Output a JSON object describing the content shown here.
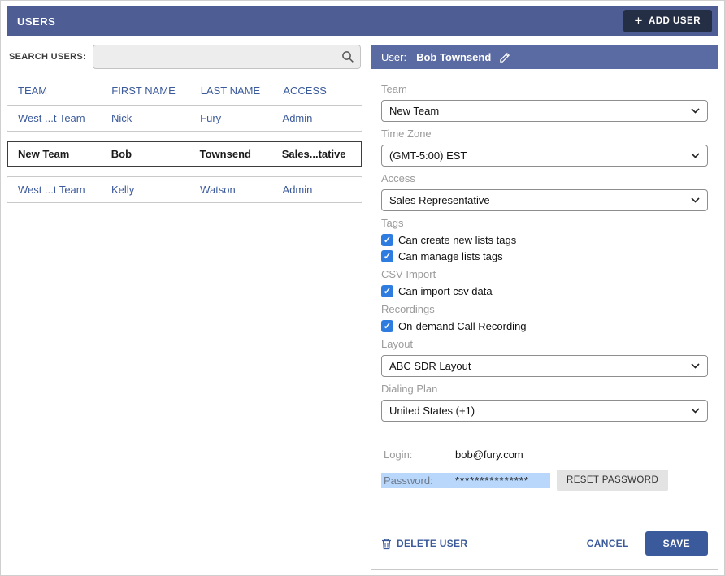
{
  "topbar": {
    "title": "USERS",
    "add_user_label": "ADD USER"
  },
  "search": {
    "label": "SEARCH USERS:",
    "value": ""
  },
  "table": {
    "columns": [
      "TEAM",
      "FIRST NAME",
      "LAST NAME",
      "ACCESS"
    ],
    "rows": [
      {
        "team": "West ...t Team",
        "first": "Nick",
        "last": "Fury",
        "access": "Admin"
      },
      {
        "team": "New Team",
        "first": "Bob",
        "last": "Townsend",
        "access": "Sales...tative"
      },
      {
        "team": "West ...t Team",
        "first": "Kelly",
        "last": "Watson",
        "access": "Admin"
      }
    ]
  },
  "detail": {
    "header": {
      "label": "User:",
      "name": "Bob Townsend"
    },
    "team": {
      "label": "Team",
      "value": "New Team"
    },
    "timezone": {
      "label": "Time Zone",
      "value": "(GMT-5:00) EST"
    },
    "access": {
      "label": "Access",
      "value": "Sales Representative"
    },
    "tags": {
      "label": "Tags",
      "option1": {
        "label": "Can create new lists tags",
        "checked": true
      },
      "option2": {
        "label": "Can manage lists tags",
        "checked": true
      }
    },
    "csv": {
      "label": "CSV Import",
      "option1": {
        "label": "Can import csv data",
        "checked": true
      }
    },
    "recordings": {
      "label": "Recordings",
      "option1": {
        "label": "On-demand Call Recording",
        "checked": true
      }
    },
    "layout": {
      "label": "Layout",
      "value": "ABC SDR Layout"
    },
    "dialing": {
      "label": "Dialing Plan",
      "value": "United States (+1)"
    },
    "login": {
      "label": "Login:",
      "value": "bob@fury.com"
    },
    "password": {
      "label": "Password:",
      "value": "***************",
      "reset_label": "RESET PASSWORD"
    },
    "footer": {
      "delete_label": "DELETE USER",
      "cancel_label": "CANCEL",
      "save_label": "SAVE"
    }
  },
  "icons": {
    "check": "✓",
    "plus": "+"
  },
  "colors": {
    "topbar": "#4e5e94",
    "panel_header": "#5a6aa2",
    "link_blue": "#3b5a9b",
    "checkbox_blue": "#2f7ce0",
    "selection_highlight": "#b8d7fb",
    "add_user_bg": "#242e45",
    "save_bg": "#3b5a9b"
  }
}
